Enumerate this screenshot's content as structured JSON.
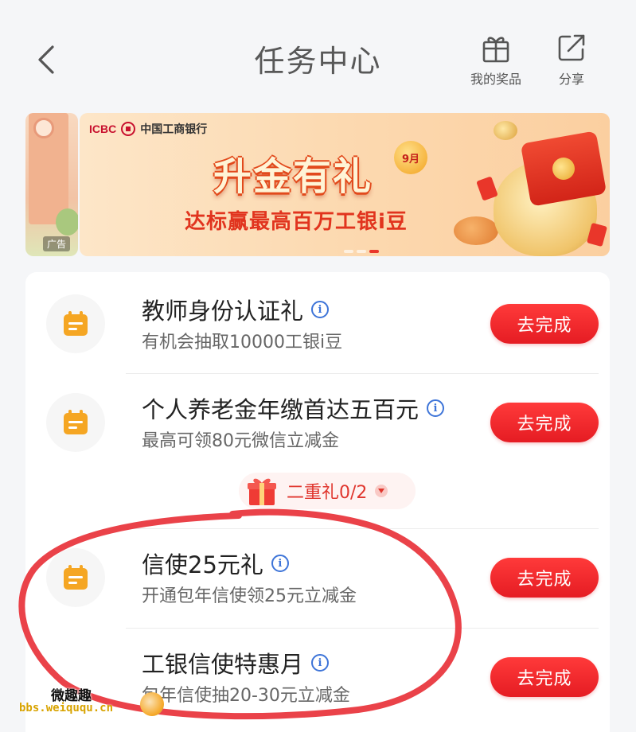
{
  "header": {
    "title": "任务中心",
    "prizes_label": "我的奖品",
    "share_label": "分享"
  },
  "banner": {
    "ad_label": "广告",
    "bank_brand": "ICBC",
    "bank_name": "中国工商银行",
    "headline": "升金有礼",
    "month_badge": "9月",
    "subtitle": "达标赢最高百万工银i豆"
  },
  "tasks": [
    {
      "title": "教师身份认证礼",
      "desc": "有机会抽取10000工银i豆",
      "action": "去完成"
    },
    {
      "title": "个人养老金年缴首达五百元",
      "desc": "最高可领80元微信立减金",
      "action": "去完成",
      "bonus": "二重礼0/2"
    },
    {
      "title": "信使25元礼",
      "desc": "开通包年信使领25元立减金",
      "action": "去完成"
    },
    {
      "title": "工银信使特惠月",
      "desc": "包年信使抽20-30元立减金",
      "action": "去完成"
    }
  ],
  "watermark": {
    "name": "微趣趣",
    "url": "bbs.weiququ.cn"
  },
  "colors": {
    "accent_red": "#e51c23",
    "icon_orange": "#f5a623",
    "info_blue": "#3d74d8",
    "annotation_red": "#e8323a"
  },
  "icons": {
    "back": "chevron-left-icon",
    "prizes": "gift-icon",
    "share": "share-icon",
    "task": "calendar-icon",
    "info": "info-icon",
    "bonus": "gift-box-icon"
  }
}
